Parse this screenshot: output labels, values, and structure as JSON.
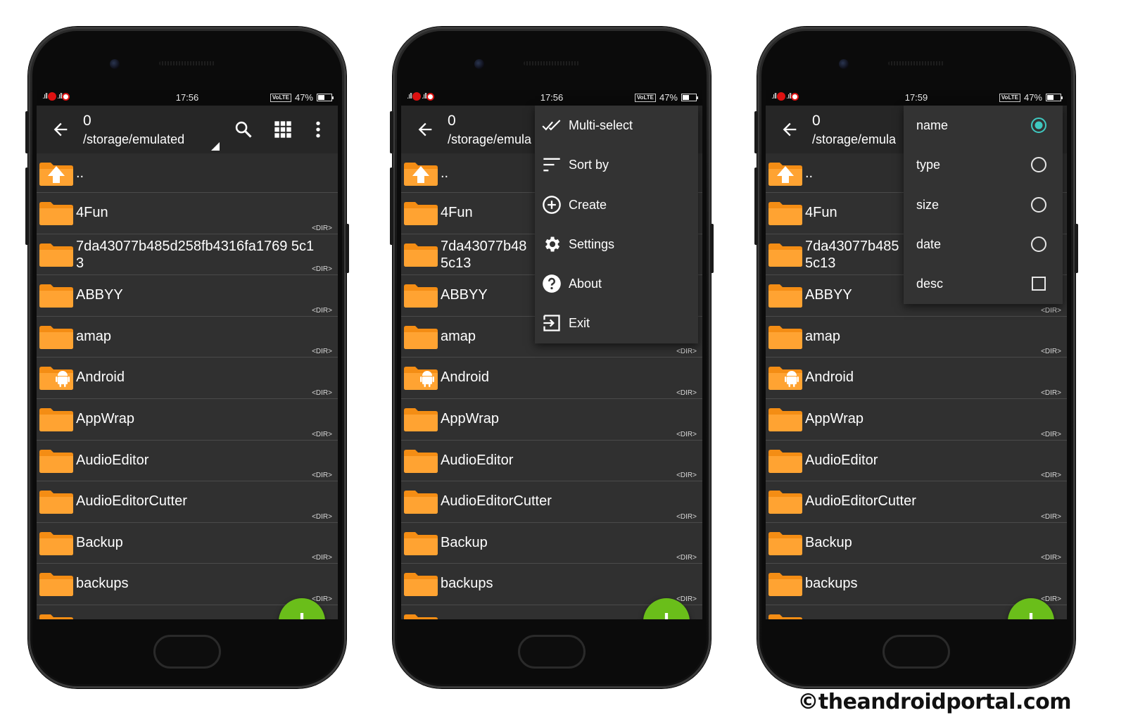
{
  "status_bar": {
    "time_1": "17:56",
    "time_2": "17:56",
    "time_3": "17:59",
    "volte": "VoLTE",
    "battery": "47%"
  },
  "toolbar": {
    "count": "0",
    "path": "/storage/emulated",
    "path_truncated": "/storage/emula"
  },
  "files": {
    "up": "..",
    "dir_label": "<DIR>",
    "items": [
      {
        "name": "4Fun",
        "icon": "folder-icon"
      },
      {
        "name": "7da43077b485d258fb4316fa1769 5c13",
        "icon": "folder-icon"
      },
      {
        "name": "ABBYY",
        "icon": "folder-icon"
      },
      {
        "name": "amap",
        "icon": "folder-icon"
      },
      {
        "name": "Android",
        "icon": "android-folder-icon"
      },
      {
        "name": "AppWrap",
        "icon": "folder-icon"
      },
      {
        "name": "AudioEditor",
        "icon": "folder-icon"
      },
      {
        "name": "AudioEditorCutter",
        "icon": "folder-icon"
      },
      {
        "name": "Backup",
        "icon": "folder-icon"
      },
      {
        "name": "backups",
        "icon": "folder-icon"
      }
    ],
    "item_1_trunc": "7da43077b48",
    "item_1_trunc_b": "7da43077b485",
    "item_1_line2": "5c13"
  },
  "overflow_menu": {
    "items": [
      {
        "label": "Multi-select",
        "icon": "double-check-icon"
      },
      {
        "label": "Sort by",
        "icon": "sort-icon"
      },
      {
        "label": "Create",
        "icon": "add-circle-icon"
      },
      {
        "label": "Settings",
        "icon": "gear-icon"
      },
      {
        "label": "About",
        "icon": "help-icon"
      },
      {
        "label": "Exit",
        "icon": "exit-icon"
      }
    ]
  },
  "sort_menu": {
    "items": [
      {
        "label": "name",
        "control": "radio",
        "selected": true
      },
      {
        "label": "type",
        "control": "radio",
        "selected": false
      },
      {
        "label": "size",
        "control": "radio",
        "selected": false
      },
      {
        "label": "date",
        "control": "radio",
        "selected": false
      },
      {
        "label": "desc",
        "control": "checkbox",
        "selected": false
      }
    ]
  },
  "colors": {
    "accent": "#6abe1a",
    "folder": "#f7941d",
    "background": "#303030",
    "radio_selected": "#3fc8c0"
  },
  "watermark": "©theandroidportal.com"
}
